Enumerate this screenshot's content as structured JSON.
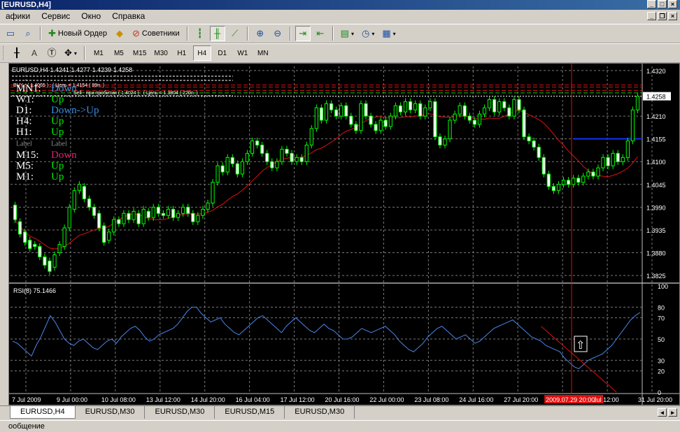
{
  "window": {
    "title": "[EURUSD,H4]"
  },
  "menu": {
    "items": [
      "афики",
      "Сервис",
      "Окно",
      "Справка"
    ]
  },
  "toolbar1": {
    "new_order_label": "Новый Ордер",
    "advisors_label": "Советники"
  },
  "toolbar2": {
    "text_tool": "A",
    "timeframes": [
      "M1",
      "M5",
      "M15",
      "M30",
      "H1",
      "H4",
      "D1",
      "W1",
      "MN"
    ],
    "active_timeframe": "H4"
  },
  "chart": {
    "header": "EURUSD,H4  1.4241 1.4277 1.4239 1.4258",
    "current_price": "1.4258",
    "levels": {
      "buy": "BUY : ( 1.4065 )  : ( Цель = 1.4154 ( 89п. )",
      "sell": "Sell - при пробитии ( 1.4024 )  : ( Цель = 1.3804 ( 220п. )"
    },
    "trend_rows": [
      {
        "tf": "MN1:",
        "state": "Down",
        "color": "#3a8ee6"
      },
      {
        "tf": "W1:",
        "state": "Up",
        "color": "#00ee00"
      },
      {
        "tf": "D1:",
        "state": "Down->Up",
        "color": "#3a8ee6"
      },
      {
        "tf": "H4:",
        "state": "Up",
        "color": "#00ee00"
      },
      {
        "tf": "H1:",
        "state": "Up",
        "color": "#00ee00"
      },
      {
        "tf": "Label",
        "state": "Label",
        "color": "#8a8a8a"
      },
      {
        "tf": "M15:",
        "state": "Down",
        "color": "#e0207a"
      },
      {
        "tf": "M5:",
        "state": "Up",
        "color": "#00ee00"
      },
      {
        "tf": "M1:",
        "state": "Up",
        "color": "#00ee00"
      }
    ],
    "price_ticks": [
      "1.4320",
      "1.4210",
      "1.4155",
      "1.4100",
      "1.4045",
      "1.3990",
      "1.3935",
      "1.3880",
      "1.3825"
    ],
    "rsi": {
      "label": "RSI(8) 75.1466",
      "ticks": [
        "100",
        "80",
        "70",
        "50",
        "30",
        "20",
        "0"
      ]
    },
    "time_ticks": [
      "7 Jul 2009",
      "9 Jul 00:00",
      "10 Jul 08:00",
      "13 Jul 12:00",
      "14 Jul 20:00",
      "16 Jul 04:00",
      "17 Jul 12:00",
      "20 Jul 16:00",
      "22 Jul 00:00",
      "23 Jul 08:00",
      "24 Jul 16:00",
      "27 Jul 20:00",
      "2009.07.29 20:00",
      "Jul 12:00",
      "31 Jul 20:00"
    ],
    "arrow_glyph": "⇧",
    "colors": {
      "bull": "#00ff00",
      "grid": "#7a7a7a",
      "ma": "#e01010",
      "rsi": "#4a86e8",
      "crosshair": "#e01010",
      "target": "#1030ff"
    }
  },
  "tabs": [
    {
      "label": "EURUSD,H4",
      "active": true
    },
    {
      "label": "EURUSD,M30",
      "active": false
    },
    {
      "label": "EURUSD,M30",
      "active": false
    },
    {
      "label": "EURUSD,M15",
      "active": false
    },
    {
      "label": "EURUSD,M30",
      "active": false
    }
  ],
  "status": {
    "text": "ообщение"
  },
  "chart_data": {
    "type": "candlestick",
    "price_ylim": [
      1.381,
      1.433
    ],
    "rsi_ylim": [
      0,
      100
    ],
    "candles": [
      [
        1.3995,
        1.396
      ],
      [
        1.3955,
        1.3925
      ],
      [
        1.393,
        1.3905
      ],
      [
        1.391,
        1.389
      ],
      [
        1.39,
        1.3895
      ],
      [
        1.3895,
        1.387
      ],
      [
        1.387,
        1.385
      ],
      [
        1.386,
        1.3835
      ],
      [
        1.3845,
        1.3875
      ],
      [
        1.388,
        1.39
      ],
      [
        1.3895,
        1.394
      ],
      [
        1.394,
        1.399
      ],
      [
        1.3985,
        1.403
      ],
      [
        1.403,
        1.4045
      ],
      [
        1.404,
        1.401
      ],
      [
        1.401,
        1.399
      ],
      [
        1.399,
        1.397
      ],
      [
        1.3975,
        1.394
      ],
      [
        1.3945,
        1.3905
      ],
      [
        1.391,
        1.393
      ],
      [
        1.393,
        1.396
      ],
      [
        1.396,
        1.395
      ],
      [
        1.395,
        1.3975
      ],
      [
        1.3975,
        1.396
      ],
      [
        1.396,
        1.398
      ],
      [
        1.3975,
        1.395
      ],
      [
        1.395,
        1.3985
      ],
      [
        1.398,
        1.3965
      ],
      [
        1.3965,
        1.399
      ],
      [
        1.399,
        1.3975
      ],
      [
        1.3975,
        1.397
      ],
      [
        1.397,
        1.3985
      ],
      [
        1.3985,
        1.3965
      ],
      [
        1.3965,
        1.3975
      ],
      [
        1.3975,
        1.399
      ],
      [
        1.399,
        1.3975
      ],
      [
        1.3975,
        1.3955
      ],
      [
        1.3955,
        1.397
      ],
      [
        1.397,
        1.3985
      ],
      [
        1.3985,
        1.4
      ],
      [
        1.4,
        1.405
      ],
      [
        1.405,
        1.409
      ],
      [
        1.409,
        1.4075
      ],
      [
        1.4075,
        1.411
      ],
      [
        1.411,
        1.4095
      ],
      [
        1.4095,
        1.407
      ],
      [
        1.407,
        1.41
      ],
      [
        1.41,
        1.412
      ],
      [
        1.412,
        1.415
      ],
      [
        1.415,
        1.414
      ],
      [
        1.414,
        1.412
      ],
      [
        1.412,
        1.41
      ],
      [
        1.41,
        1.4085
      ],
      [
        1.4085,
        1.41
      ],
      [
        1.41,
        1.413
      ],
      [
        1.413,
        1.412
      ],
      [
        1.412,
        1.41
      ],
      [
        1.41,
        1.411
      ],
      [
        1.411,
        1.41
      ],
      [
        1.41,
        1.414
      ],
      [
        1.414,
        1.418
      ],
      [
        1.418,
        1.423
      ],
      [
        1.423,
        1.42
      ],
      [
        1.42,
        1.424
      ],
      [
        1.424,
        1.4225
      ],
      [
        1.4225,
        1.421
      ],
      [
        1.421,
        1.4235
      ],
      [
        1.4235,
        1.421
      ],
      [
        1.421,
        1.419
      ],
      [
        1.419,
        1.4175
      ],
      [
        1.4175,
        1.424
      ],
      [
        1.424,
        1.421
      ],
      [
        1.421,
        1.419
      ],
      [
        1.419,
        1.4175
      ],
      [
        1.4175,
        1.42
      ],
      [
        1.42,
        1.4185
      ],
      [
        1.4185,
        1.421
      ],
      [
        1.421,
        1.4235
      ],
      [
        1.4235,
        1.422
      ],
      [
        1.422,
        1.4245
      ],
      [
        1.4245,
        1.4225
      ],
      [
        1.4225,
        1.424
      ],
      [
        1.424,
        1.421
      ],
      [
        1.421,
        1.423
      ],
      [
        1.423,
        1.4245
      ],
      [
        1.4245,
        1.416
      ],
      [
        1.416,
        1.414
      ],
      [
        1.414,
        1.4155
      ],
      [
        1.4155,
        1.42
      ],
      [
        1.42,
        1.4215
      ],
      [
        1.4215,
        1.4235
      ],
      [
        1.4235,
        1.421
      ],
      [
        1.421,
        1.42
      ],
      [
        1.42,
        1.419
      ],
      [
        1.419,
        1.4215
      ],
      [
        1.4215,
        1.423
      ],
      [
        1.423,
        1.425
      ],
      [
        1.425,
        1.422
      ],
      [
        1.422,
        1.4245
      ],
      [
        1.4245,
        1.423
      ],
      [
        1.423,
        1.421
      ],
      [
        1.421,
        1.425
      ],
      [
        1.425,
        1.4225
      ],
      [
        1.4225,
        1.416
      ],
      [
        1.416,
        1.415
      ],
      [
        1.415,
        1.4135
      ],
      [
        1.4135,
        1.411
      ],
      [
        1.411,
        1.407
      ],
      [
        1.407,
        1.404
      ],
      [
        1.404,
        1.403
      ],
      [
        1.403,
        1.4045
      ],
      [
        1.4045,
        1.4055
      ],
      [
        1.4055,
        1.4045
      ],
      [
        1.4045,
        1.406
      ],
      [
        1.406,
        1.405
      ],
      [
        1.405,
        1.4065
      ],
      [
        1.4065,
        1.4075
      ],
      [
        1.4075,
        1.4065
      ],
      [
        1.4065,
        1.4085
      ],
      [
        1.4085,
        1.411
      ],
      [
        1.411,
        1.409
      ],
      [
        1.409,
        1.412
      ],
      [
        1.412,
        1.41
      ],
      [
        1.41,
        1.411
      ],
      [
        1.411,
        1.415
      ],
      [
        1.415,
        1.4225
      ],
      [
        1.4225,
        1.4258
      ]
    ],
    "rsi_values": [
      48,
      46,
      42,
      38,
      34,
      44,
      52,
      62,
      72,
      66,
      58,
      50,
      46,
      44,
      48,
      50,
      46,
      42,
      40,
      44,
      48,
      50,
      46,
      52,
      56,
      60,
      62,
      58,
      52,
      48,
      50,
      54,
      56,
      58,
      60,
      64,
      70,
      76,
      80,
      80,
      74,
      70,
      66,
      68,
      70,
      64,
      60,
      56,
      54,
      58,
      62,
      66,
      70,
      72,
      68,
      64,
      60,
      56,
      62,
      66,
      70,
      66,
      62,
      58,
      56,
      60,
      64,
      60,
      58,
      54,
      50,
      50,
      52,
      56,
      60,
      58,
      56,
      58,
      60,
      62,
      58,
      54,
      48,
      44,
      40,
      38,
      42,
      46,
      52,
      56,
      60,
      62,
      58,
      54,
      50,
      52,
      54,
      50,
      46,
      48,
      52,
      56,
      60,
      62,
      64,
      66,
      68,
      64,
      60,
      56,
      52,
      50,
      48,
      44,
      42,
      40,
      38,
      32,
      28,
      24,
      22,
      26,
      30,
      32,
      34,
      36,
      40,
      44,
      50,
      56,
      62,
      68,
      72,
      75
    ]
  }
}
